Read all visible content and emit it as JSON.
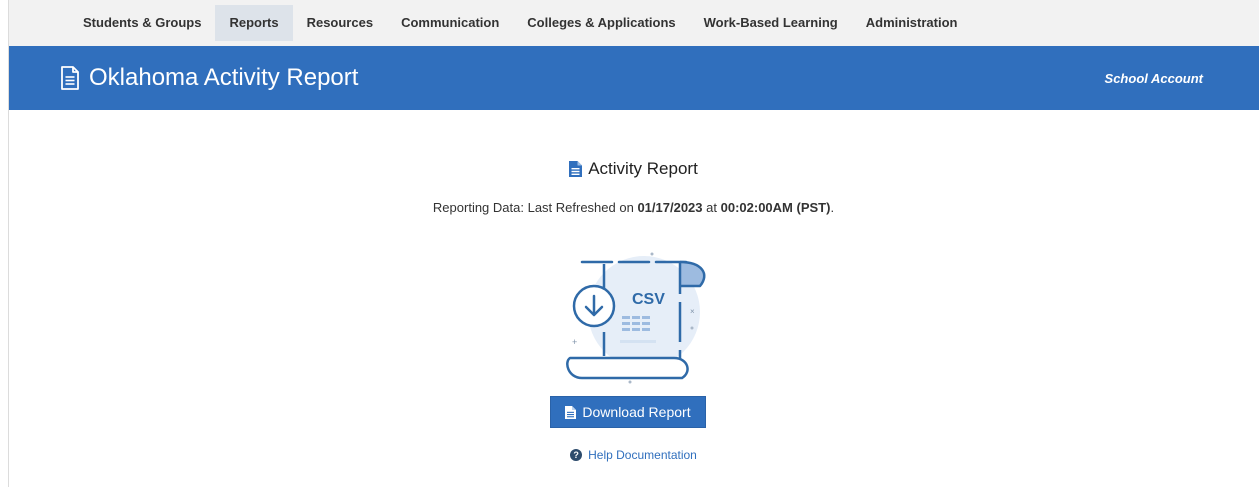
{
  "nav": {
    "items": [
      {
        "label": "Students & Groups",
        "active": false
      },
      {
        "label": "Reports",
        "active": true
      },
      {
        "label": "Resources",
        "active": false
      },
      {
        "label": "Communication",
        "active": false
      },
      {
        "label": "Colleges & Applications",
        "active": false
      },
      {
        "label": "Work-Based Learning",
        "active": false
      },
      {
        "label": "Administration",
        "active": false
      }
    ]
  },
  "banner": {
    "title": "Oklahoma Activity Report",
    "account": "School Account",
    "icon": "document-icon"
  },
  "card": {
    "title": "Activity Report",
    "refresh_prefix": "Reporting Data: Last Refreshed on",
    "refresh_date": "01/17/2023",
    "refresh_mid": "at",
    "refresh_time": "00:02:00AM (PST)",
    "refresh_suffix": ".",
    "illustration_label": "CSV",
    "download_label": "Download Report",
    "help_label": "Help Documentation"
  },
  "colors": {
    "brand_blue": "#306fbd",
    "nav_bg": "#f2f2f2",
    "nav_active": "#dde3ea"
  }
}
